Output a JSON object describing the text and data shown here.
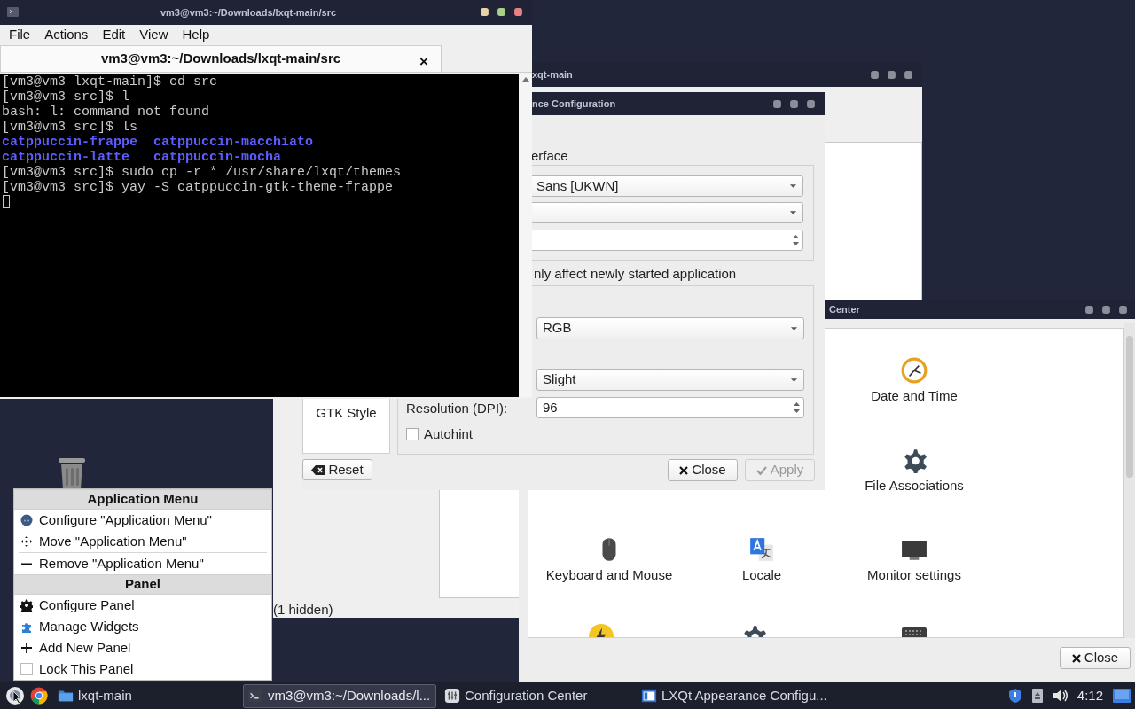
{
  "terminal": {
    "title": "vm3@vm3:~/Downloads/lxqt-main/src",
    "menu": [
      "File",
      "Actions",
      "Edit",
      "View",
      "Help"
    ],
    "tab": {
      "title": "vm3@vm3:~/Downloads/lxqt-main/src",
      "close": "×"
    },
    "lines": [
      {
        "kind": "plain",
        "text": "[vm3@vm3 lxqt-main]$ cd src"
      },
      {
        "kind": "plain",
        "text": "[vm3@vm3 src]$ l"
      },
      {
        "kind": "plain",
        "text": "bash: l: command not found"
      },
      {
        "kind": "plain",
        "text": "[vm3@vm3 src]$ ls"
      },
      {
        "kind": "listing",
        "text": "catppuccin-frappe  catppuccin-macchiato"
      },
      {
        "kind": "listing",
        "text": "catppuccin-latte   catppuccin-mocha"
      },
      {
        "kind": "plain",
        "text": "[vm3@vm3 src]$ sudo cp -r * /usr/share/lxqt/themes"
      },
      {
        "kind": "plain",
        "text": "[vm3@vm3 src]$ yay -S catppuccin-gtk-theme-frappe"
      }
    ]
  },
  "file_manager": {
    "title": "xqt-main",
    "status": "(1 hidden)"
  },
  "appearance": {
    "title": "nce Configuration",
    "section": "erface",
    "font": "Sans [UKWN]",
    "note": "nly affect newly started application",
    "subpixel": "RGB",
    "hinting": "Slight",
    "dpi_label": "Resolution (DPI):",
    "dpi": "96",
    "autohint": {
      "label": "Autohint",
      "checked": false
    },
    "page": "GTK Style",
    "reset": "Reset",
    "close": "Close",
    "apply": {
      "label": "Apply",
      "disabled": true
    }
  },
  "config_center": {
    "title": "Center",
    "items": [
      {
        "label": "Date and Time",
        "kind": "clock"
      },
      {
        "label": "File Associations",
        "kind": "gear"
      },
      {
        "label": "Keyboard and Mouse",
        "kind": "mouse"
      },
      {
        "label": "Locale",
        "kind": "locale"
      },
      {
        "label": "Monitor settings",
        "kind": "monitor"
      }
    ],
    "close": "Close"
  },
  "context_menu": {
    "sections": [
      {
        "title": "Application Menu",
        "items": [
          {
            "label": "Configure \"Application Menu\"",
            "kind": "configure"
          },
          {
            "label": "Move \"Application Menu\"",
            "kind": "move"
          },
          {
            "label": "Remove \"Application Menu\"",
            "kind": "remove"
          }
        ]
      },
      {
        "title": "Panel",
        "items": [
          {
            "label": "Configure Panel",
            "kind": "gear"
          },
          {
            "label": "Manage Widgets",
            "kind": "puzzle"
          },
          {
            "label": "Add New Panel",
            "kind": "add"
          },
          {
            "label": "Lock This Panel",
            "kind": "check",
            "checked": false
          }
        ]
      }
    ]
  },
  "taskbar": {
    "tasks": [
      {
        "label": "lxqt-main",
        "kind": "folder",
        "selected": false
      },
      {
        "label": "vm3@vm3:~/Downloads/l...",
        "kind": "terminal",
        "selected": true
      },
      {
        "label": "Configuration Center",
        "kind": "config",
        "selected": false
      },
      {
        "label": "LXQt Appearance Configu...",
        "kind": "appearance",
        "selected": false
      }
    ],
    "clock": "4:12"
  }
}
